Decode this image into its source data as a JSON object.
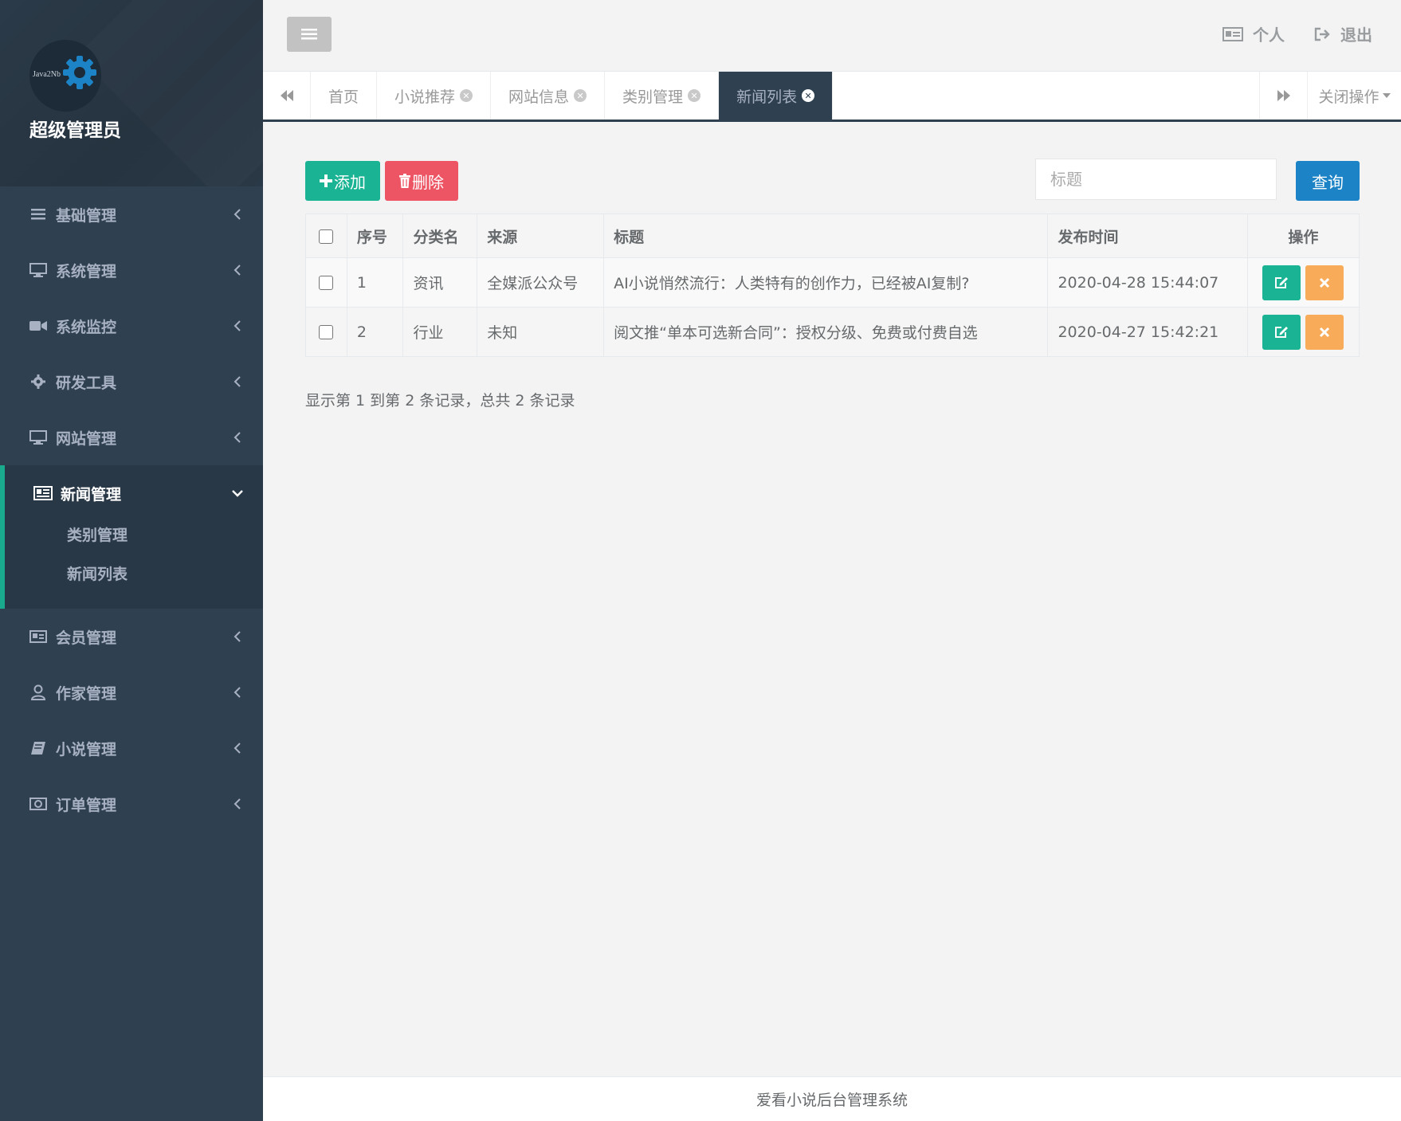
{
  "sidebar": {
    "avatar_text": "Java2Nb",
    "user_name": "超级管理员",
    "items": [
      {
        "label": "基础管理",
        "icon": "bars-icon"
      },
      {
        "label": "系统管理",
        "icon": "desktop-icon"
      },
      {
        "label": "系统监控",
        "icon": "video-camera-icon"
      },
      {
        "label": "研发工具",
        "icon": "gear-icon"
      },
      {
        "label": "网站管理",
        "icon": "desktop-icon"
      }
    ],
    "active_item": {
      "label": "新闻管理",
      "icon": "newspaper-icon",
      "children": [
        {
          "label": "类别管理"
        },
        {
          "label": "新闻列表"
        }
      ]
    },
    "items_after": [
      {
        "label": "会员管理",
        "icon": "id-card-icon"
      },
      {
        "label": "作家管理",
        "icon": "user-icon"
      },
      {
        "label": "小说管理",
        "icon": "book-icon"
      },
      {
        "label": "订单管理",
        "icon": "money-icon"
      }
    ]
  },
  "topbar": {
    "profile_label": "个人",
    "logout_label": "退出"
  },
  "tabs": {
    "items": [
      {
        "label": "首页",
        "closable": false,
        "active": false
      },
      {
        "label": "小说推荐",
        "closable": true,
        "active": false
      },
      {
        "label": "网站信息",
        "closable": true,
        "active": false
      },
      {
        "label": "类别管理",
        "closable": true,
        "active": false
      },
      {
        "label": "新闻列表",
        "closable": true,
        "active": true
      }
    ],
    "close_ops_label": "关闭操作"
  },
  "toolbar": {
    "add_label": "添加",
    "delete_label": "删除",
    "search_placeholder": "标题",
    "query_label": "查询"
  },
  "table": {
    "columns": [
      "序号",
      "分类名",
      "来源",
      "标题",
      "发布时间",
      "操作"
    ],
    "rows": [
      {
        "no": "1",
        "category": "资讯",
        "source": "全媒派公众号",
        "title": "AI小说悄然流行：人类特有的创作力，已经被AI复制?",
        "time": "2020-04-28 15:44:07"
      },
      {
        "no": "2",
        "category": "行业",
        "source": "未知",
        "title": "阅文推“单本可选新合同”：授权分级、免费或付费自选",
        "time": "2020-04-27 15:42:21"
      }
    ]
  },
  "pager": {
    "info": "显示第 1 到第 2 条记录，总共 2 条记录"
  },
  "footer": {
    "text": "爱看小说后台管理系统"
  },
  "colors": {
    "sidebar_bg": "#2f4050",
    "accent_green": "#1ab394",
    "danger_red": "#ed5565",
    "primary_blue": "#1c84c6",
    "warning_orange": "#f8ac59"
  }
}
